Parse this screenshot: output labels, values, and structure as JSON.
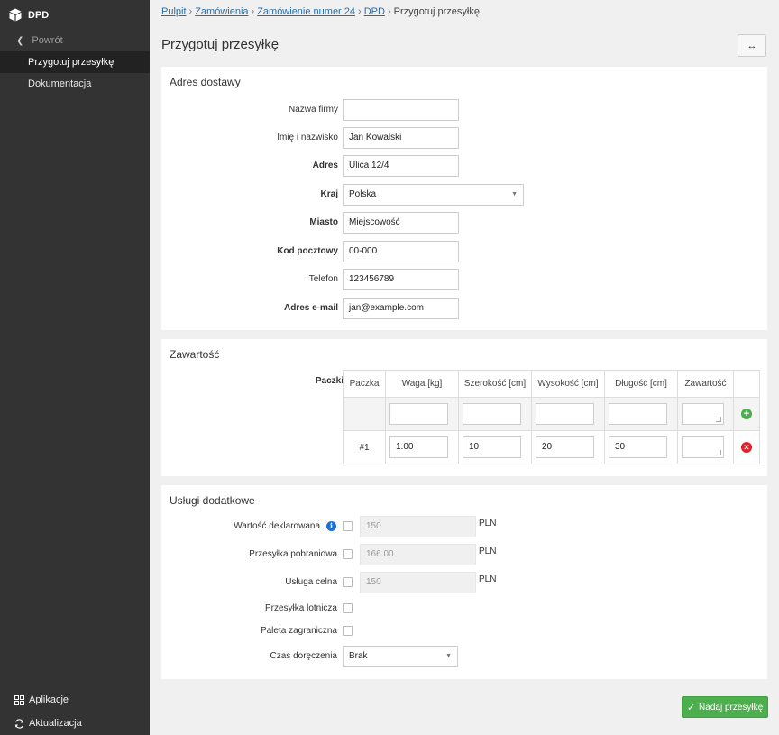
{
  "sidebar": {
    "brand": "DPD",
    "back_label": "Powrót",
    "items": [
      {
        "label": "Przygotuj przesyłkę",
        "active": true
      },
      {
        "label": "Dokumentacja",
        "active": false
      }
    ],
    "bottom": [
      {
        "label": "Aplikacje",
        "icon": "grid-icon"
      },
      {
        "label": "Aktualizacja",
        "icon": "refresh-icon"
      }
    ]
  },
  "breadcrumb": {
    "items": [
      "Pulpit",
      "Zamówienia",
      "Zamówienie numer 24",
      "DPD"
    ],
    "current": "Przygotuj przesyłkę",
    "separator": "›"
  },
  "page": {
    "title": "Przygotuj przesyłkę",
    "expand_label": "↔"
  },
  "address": {
    "title": "Adres dostawy",
    "company_label": "Nazwa firmy",
    "company_value": "",
    "name_label": "Imię i nazwisko",
    "name_value": "Jan Kowalski",
    "street_label": "Adres",
    "street_value": "Ulica 12/4",
    "country_label": "Kraj",
    "country_value": "Polska",
    "city_label": "Miasto",
    "city_value": "Miejscowość",
    "zip_label": "Kod pocztowy",
    "zip_value": "00-000",
    "phone_label": "Telefon",
    "phone_value": "123456789",
    "email_label": "Adres e-mail",
    "email_value": "jan@example.com"
  },
  "contents": {
    "title": "Zawartość",
    "packages_label": "Paczki",
    "columns": [
      "Paczka",
      "Waga [kg]",
      "Szerokość [cm]",
      "Wysokość [cm]",
      "Długość [cm]",
      "Zawartość"
    ],
    "rows": [
      {
        "num": "#1",
        "weight": "1.00",
        "width": "10",
        "height": "20",
        "length": "30",
        "content": ""
      }
    ]
  },
  "services": {
    "title": "Usługi dodatkowe",
    "declared_label": "Wartość deklarowana",
    "declared_value": "150",
    "cod_label": "Przesyłka pobraniowa",
    "cod_value": "166.00",
    "customs_label": "Usługa celna",
    "customs_value": "150",
    "currency": "PLN",
    "air_label": "Przesyłka lotnicza",
    "pallet_label": "Paleta zagraniczna",
    "delivery_time_label": "Czas doręczenia",
    "delivery_time_value": "Brak"
  },
  "actions": {
    "submit_label": "Nadaj przesyłkę"
  },
  "colors": {
    "sidebar_bg": "#333333",
    "sidebar_active": "#222222",
    "link": "#2a6ea6",
    "success": "#4cae4c",
    "danger": "#e0232a",
    "info": "#1e6fd6"
  }
}
